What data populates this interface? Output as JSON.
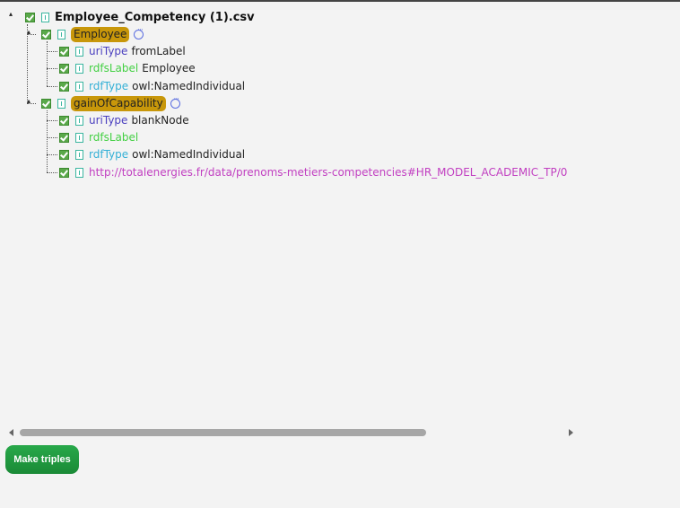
{
  "tree": {
    "root": {
      "label": "Employee_Competency (1).csv"
    },
    "nodes": [
      {
        "label": "Employee",
        "children": [
          {
            "key": "uriType",
            "value": "fromLabel"
          },
          {
            "key": "rdfsLabel",
            "value": "Employee"
          },
          {
            "key": "rdfType",
            "value": "owl:NamedIndividual"
          }
        ]
      },
      {
        "label": "gainOfCapability",
        "children": [
          {
            "key": "uriType",
            "value": "blankNode"
          },
          {
            "key": "rdfsLabel",
            "value": ""
          },
          {
            "key": "rdfType",
            "value": "owl:NamedIndividual"
          },
          {
            "link": "http://totalenergies.fr/data/prenoms-metiers-competencies#HR_MODEL_ACADEMIC_TP/0"
          }
        ]
      }
    ]
  },
  "actions": {
    "make_triples": "Make triples"
  },
  "colors": {
    "pill": "#c8970a",
    "uriType": "#4a3fbf",
    "rdfsLabel": "#44d044",
    "rdfType": "#35b0d6",
    "link": "#c13fc1",
    "button": "#1f9a3e"
  }
}
